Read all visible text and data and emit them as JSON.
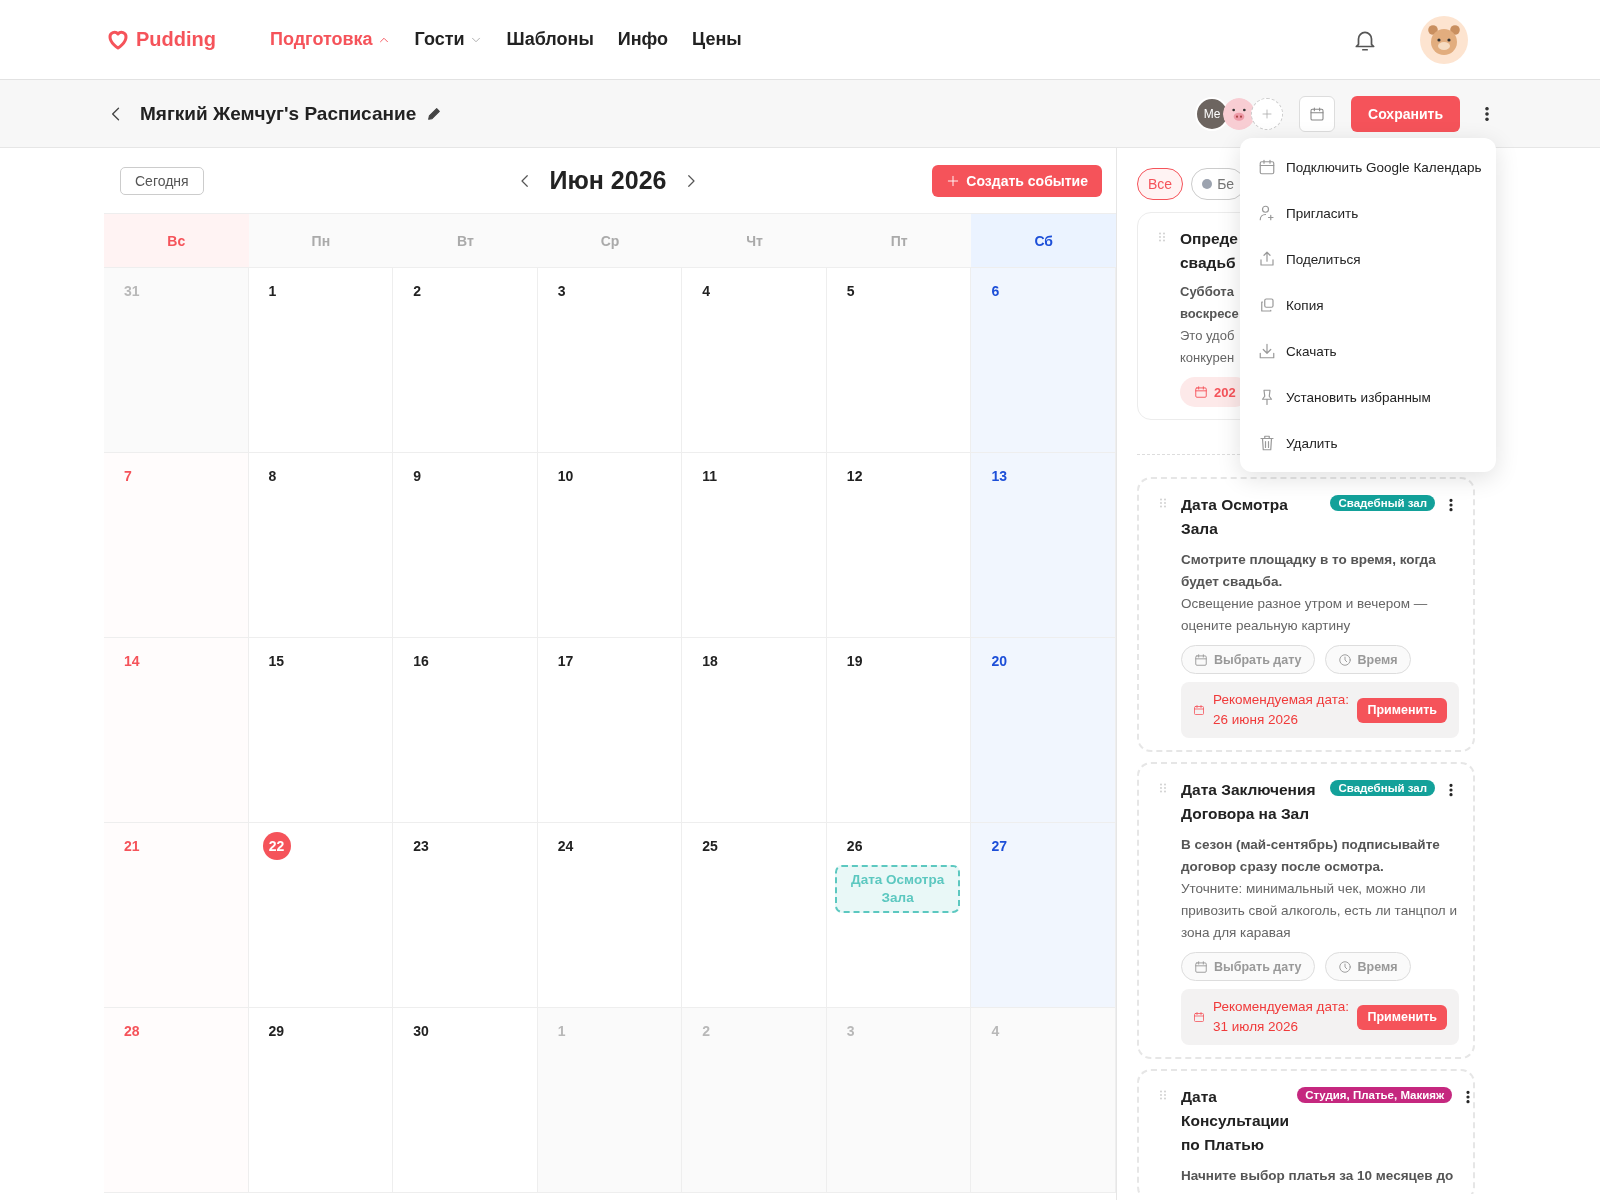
{
  "header": {
    "logo": "Pudding",
    "nav": [
      {
        "label": "Подготовка",
        "selected": true,
        "kind": "dropdown",
        "expanded": true
      },
      {
        "label": "Гости",
        "selected": false,
        "kind": "dropdown",
        "expanded": false
      },
      {
        "label": "Шаблоны",
        "selected": false,
        "kind": "link"
      },
      {
        "label": "Инфо",
        "selected": false,
        "kind": "link"
      },
      {
        "label": "Цены",
        "selected": false,
        "kind": "link"
      }
    ]
  },
  "toolbar": {
    "title": "Мягкий Жемчуг's Расписание",
    "members": [
      {
        "kind": "initials",
        "label": "Me"
      },
      {
        "kind": "avatar"
      },
      {
        "kind": "add"
      }
    ],
    "save_button": "Сохранить"
  },
  "calendar": {
    "today_button": "Сегодня",
    "month": "Июн 2026",
    "create_button": "Создать событие",
    "weekdays": [
      {
        "label": "Вс",
        "kind": "sunday"
      },
      {
        "label": "Пн",
        "kind": "weekday"
      },
      {
        "label": "Вт",
        "kind": "weekday"
      },
      {
        "label": "Ср",
        "kind": "weekday"
      },
      {
        "label": "Чт",
        "kind": "weekday"
      },
      {
        "label": "Пт",
        "kind": "weekday"
      },
      {
        "label": "Сб",
        "kind": "saturday"
      }
    ],
    "weeks": [
      [
        {
          "day": "31",
          "other_month": true,
          "today": false
        },
        {
          "day": "1",
          "other_month": false,
          "today": false
        },
        {
          "day": "2",
          "other_month": false,
          "today": false
        },
        {
          "day": "3",
          "other_month": false,
          "today": false
        },
        {
          "day": "4",
          "other_month": false,
          "today": false
        },
        {
          "day": "5",
          "other_month": false,
          "today": false
        },
        {
          "day": "6",
          "other_month": false,
          "today": false
        }
      ],
      [
        {
          "day": "7",
          "other_month": false,
          "today": false
        },
        {
          "day": "8",
          "other_month": false,
          "today": false
        },
        {
          "day": "9",
          "other_month": false,
          "today": false
        },
        {
          "day": "10",
          "other_month": false,
          "today": false
        },
        {
          "day": "11",
          "other_month": false,
          "today": false
        },
        {
          "day": "12",
          "other_month": false,
          "today": false
        },
        {
          "day": "13",
          "other_month": false,
          "today": false
        }
      ],
      [
        {
          "day": "14",
          "other_month": false,
          "today": false
        },
        {
          "day": "15",
          "other_month": false,
          "today": false
        },
        {
          "day": "16",
          "other_month": false,
          "today": false
        },
        {
          "day": "17",
          "other_month": false,
          "today": false
        },
        {
          "day": "18",
          "other_month": false,
          "today": false
        },
        {
          "day": "19",
          "other_month": false,
          "today": false
        },
        {
          "day": "20",
          "other_month": false,
          "today": false
        }
      ],
      [
        {
          "day": "21",
          "other_month": false,
          "today": false
        },
        {
          "day": "22",
          "other_month": false,
          "today": true
        },
        {
          "day": "23",
          "other_month": false,
          "today": false
        },
        {
          "day": "24",
          "other_month": false,
          "today": false
        },
        {
          "day": "25",
          "other_month": false,
          "today": false
        },
        {
          "day": "26",
          "other_month": false,
          "today": false,
          "events": [
            {
              "title": "Дата Осмотра Зала",
              "color": "#5cc8c0"
            }
          ]
        },
        {
          "day": "27",
          "other_month": false,
          "today": false
        }
      ],
      [
        {
          "day": "28",
          "other_month": false,
          "today": false
        },
        {
          "day": "29",
          "other_month": false,
          "today": false
        },
        {
          "day": "30",
          "other_month": false,
          "today": false
        },
        {
          "day": "1",
          "other_month": true,
          "today": false
        },
        {
          "day": "2",
          "other_month": true,
          "today": false
        },
        {
          "day": "3",
          "other_month": true,
          "today": false
        },
        {
          "day": "4",
          "other_month": true,
          "today": false
        }
      ]
    ]
  },
  "panel": {
    "filters": [
      {
        "label": "Все",
        "selected": true
      },
      {
        "label": "Бе",
        "selected": false,
        "color": "#9ca3af"
      }
    ],
    "cards": [
      {
        "kind": "covered",
        "title_lines": [
          "Опреде",
          "свадьб"
        ],
        "lead_lines": [
          "Суббота",
          "воскресе"
        ],
        "note_lines": [
          "Это удоб",
          "конкурен"
        ],
        "date_chip": "202"
      },
      {
        "kind": "full",
        "title": "Дата Осмотра Зала",
        "tag": {
          "label": "Свадебный зал",
          "color": "#13a19a"
        },
        "lead": "Смотрите площадку в то время, когда будет свадьба.",
        "note": "Освещение разное утром и вечером — оцените реальную картину",
        "date_button": "Выбрать дату",
        "time_button": "Время",
        "suggestion": {
          "label": "Рекомендуемая дата:",
          "date": "26 июня 2026",
          "action": "Применить"
        }
      },
      {
        "kind": "full",
        "title": "Дата Заключения Договора на Зал",
        "tag": {
          "label": "Свадебный зал",
          "color": "#13a19a"
        },
        "lead": "В сезон (май-сентябрь) подписывайте договор сразу после осмотра.",
        "note": "Уточните: минимальный чек, можно ли привозить свой алкоголь, есть ли танцпол и зона для каравая",
        "date_button": "Выбрать дату",
        "time_button": "Время",
        "suggestion": {
          "label": "Рекомендуемая дата:",
          "date": "31 июля 2026",
          "action": "Применить"
        }
      },
      {
        "kind": "full",
        "title": "Дата Консультации по Платью",
        "tag": {
          "label": "Студия, Платье, Макияж",
          "color": "#c5287f"
        },
        "lead": "Начните выбор платья за 10 месяцев до"
      }
    ]
  },
  "menu": {
    "items": [
      {
        "label": "Подключить Google Календарь",
        "kind": "calendar"
      },
      {
        "label": "Пригласить",
        "kind": "invite"
      },
      {
        "label": "Поделиться",
        "kind": "share"
      },
      {
        "label": "Копия",
        "kind": "copy"
      },
      {
        "label": "Скачать",
        "kind": "download"
      },
      {
        "label": "Установить избранным",
        "kind": "pin"
      },
      {
        "label": "Удалить",
        "kind": "delete"
      }
    ]
  }
}
